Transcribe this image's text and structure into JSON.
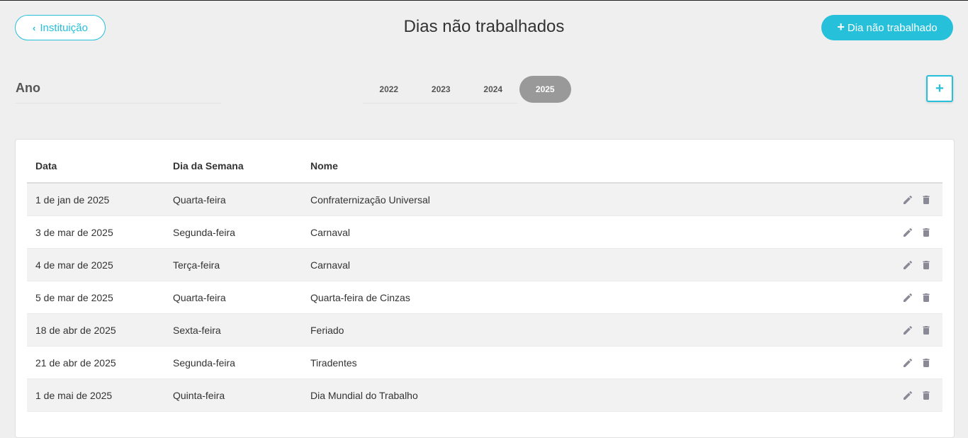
{
  "header": {
    "back_label": "Instituição",
    "title": "Dias não trabalhados",
    "add_day_label": "Dia não trabalhado"
  },
  "year_section": {
    "label": "Ano",
    "years": [
      "2022",
      "2023",
      "2024",
      "2025"
    ],
    "selected": "2025",
    "add_label": "+"
  },
  "table": {
    "headers": [
      "Data",
      "Dia da Semana",
      "Nome"
    ],
    "rows": [
      {
        "date": "1 de jan de 2025",
        "weekday": "Quarta-feira",
        "name": "Confraternização Universal"
      },
      {
        "date": "3 de mar de 2025",
        "weekday": "Segunda-feira",
        "name": "Carnaval"
      },
      {
        "date": "4 de mar de 2025",
        "weekday": "Terça-feira",
        "name": "Carnaval"
      },
      {
        "date": "5 de mar de 2025",
        "weekday": "Quarta-feira",
        "name": "Quarta-feira de Cinzas"
      },
      {
        "date": "18 de abr de 2025",
        "weekday": "Sexta-feira",
        "name": "Feriado"
      },
      {
        "date": "21 de abr de 2025",
        "weekday": "Segunda-feira",
        "name": "Tiradentes"
      },
      {
        "date": "1 de mai de 2025",
        "weekday": "Quinta-feira",
        "name": "Dia Mundial do Trabalho"
      }
    ],
    "row_actions": [
      "edit-icon",
      "trash-icon"
    ]
  },
  "colors": {
    "accent": "#26c0db",
    "selected_year_bg": "#999999",
    "icon": "#8a8a96"
  }
}
